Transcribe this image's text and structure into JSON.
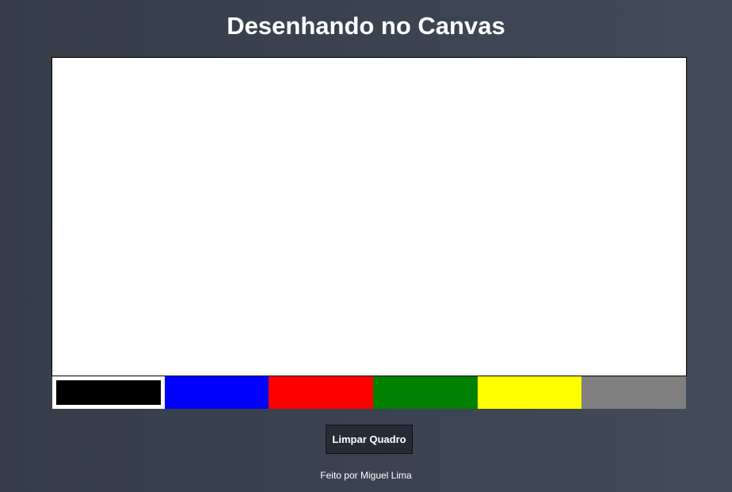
{
  "header": {
    "title": "Desenhando no Canvas"
  },
  "palette": {
    "colors": [
      {
        "name": "black",
        "hex": "#000000",
        "selected": true
      },
      {
        "name": "blue",
        "hex": "#0000ff",
        "selected": false
      },
      {
        "name": "red",
        "hex": "#ff0000",
        "selected": false
      },
      {
        "name": "green",
        "hex": "#008000",
        "selected": false
      },
      {
        "name": "yellow",
        "hex": "#ffff00",
        "selected": false
      },
      {
        "name": "gray",
        "hex": "#808080",
        "selected": false
      }
    ]
  },
  "controls": {
    "clear_label": "Limpar Quadro"
  },
  "footer": {
    "credit": "Feito por Miguel Lima"
  }
}
